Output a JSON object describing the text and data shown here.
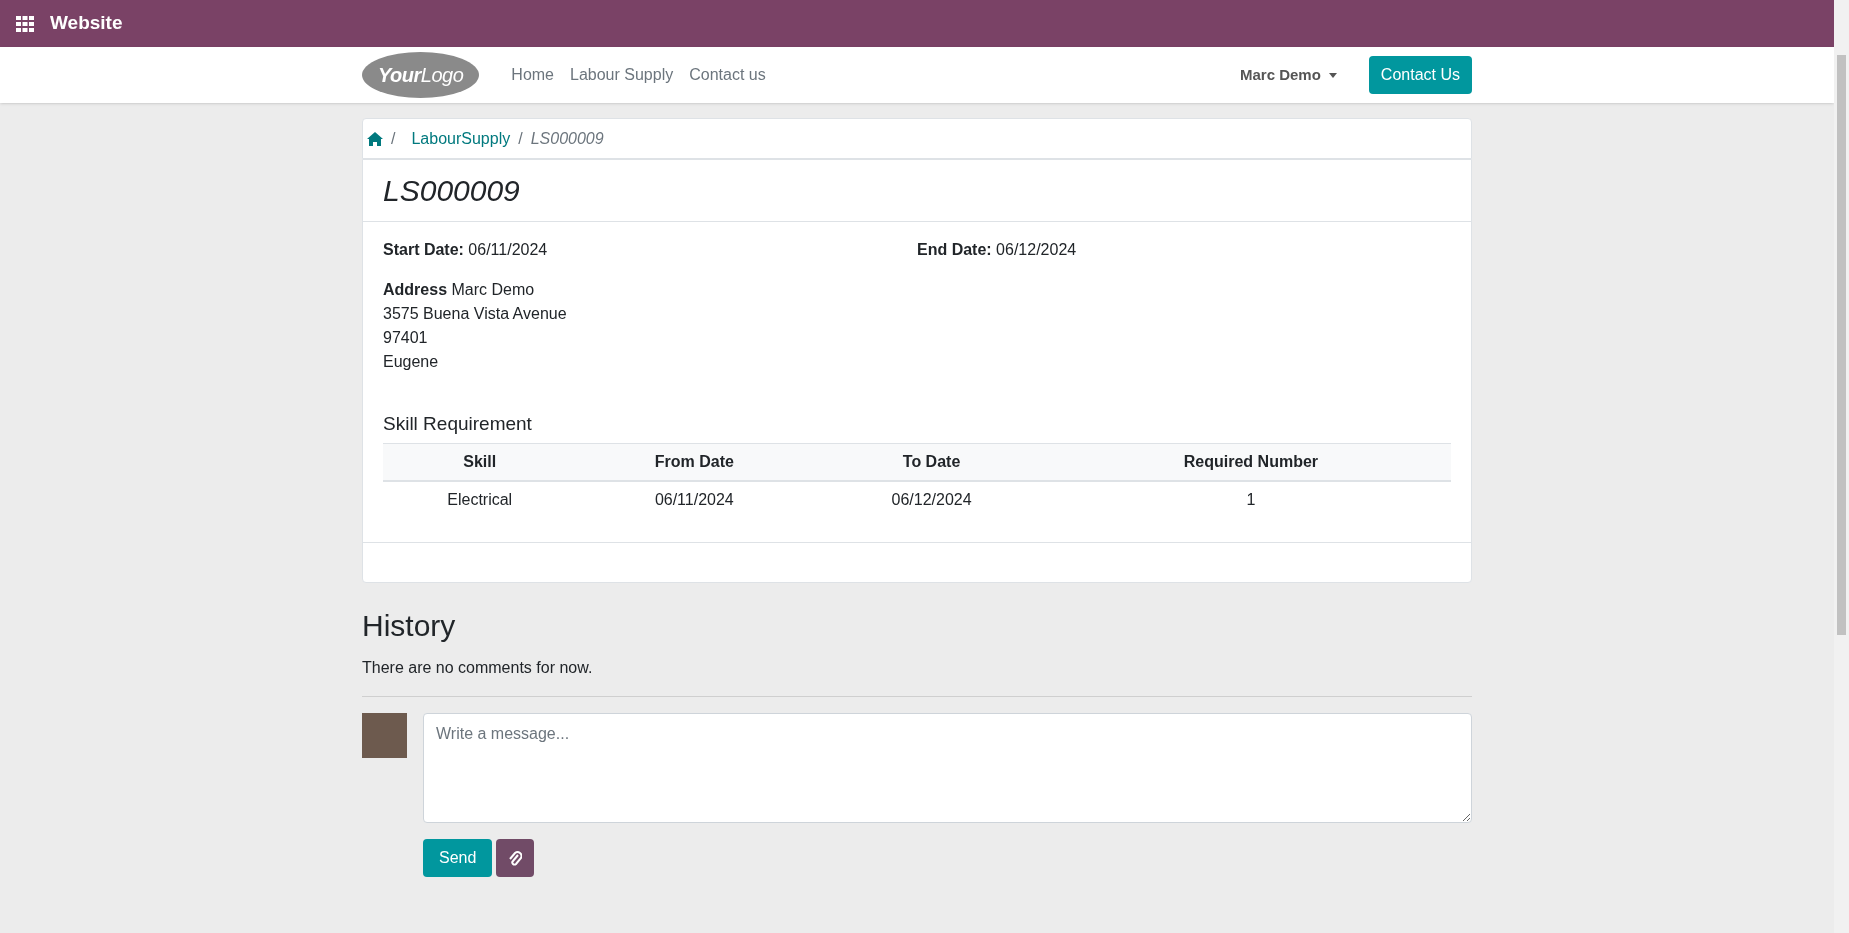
{
  "app_bar": {
    "title": "Website"
  },
  "navbar": {
    "logo": "**Your**Logo",
    "menu": [
      {
        "label": "Home"
      },
      {
        "label": "Labour Supply"
      },
      {
        "label": "Contact us"
      }
    ],
    "user": "Marc Demo",
    "cta": "Contact Us"
  },
  "breadcrumb": {
    "items": [
      "LabourSupply"
    ],
    "current": "LS000009",
    "separator": "/"
  },
  "record": {
    "title": "LS000009",
    "fields": [
      {
        "label": "Start Date:",
        "value": "06/11/2024"
      },
      {
        "label": "End Date:",
        "value": "06/12/2024"
      }
    ],
    "address": {
      "label": "Address",
      "lines": [
        "Marc Demo",
        "3575 Buena Vista Avenue",
        "97401",
        "Eugene"
      ]
    },
    "section_title": "Skill Requirement",
    "table": {
      "columns": [
        "Skill",
        "From Date",
        "To Date",
        "Required Number"
      ],
      "rows": [
        [
          "Electrical",
          "06/11/2024",
          "06/12/2024",
          "1"
        ]
      ]
    }
  },
  "history": {
    "title": "History",
    "empty_text": "There are no comments for now.",
    "message_placeholder": "Write a message...",
    "send": "Send"
  }
}
